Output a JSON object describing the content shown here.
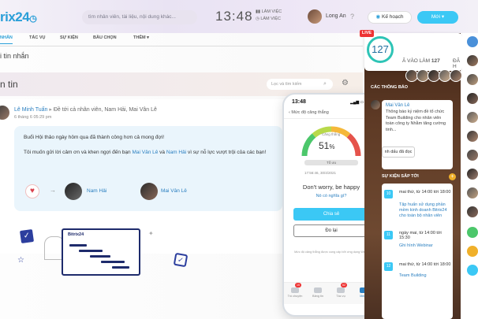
{
  "header": {
    "logo_text": "rix24",
    "search_placeholder": "tìm nhân viên, tài liệu, nội dung khác...",
    "clock": "13:48",
    "work_status_1": "LÀM VIỆC",
    "work_status_2": "LÀM VIỆC",
    "user_name": "Long An",
    "plan_button": "Kế hoạch",
    "new_button": "Mới"
  },
  "tabs": [
    "NHẮN",
    "TÁC VỤ",
    "SỰ KIỆN",
    "BẦU CHỌN",
    "THÊM ▾"
  ],
  "breadcrumb": "i tin nhắn",
  "page_title": "n tin",
  "filter_placeholder": "Lọc và tìm kiếm",
  "post": {
    "author": "Lê Minh Tuấn",
    "recipients": "Đề tới cả nhân viên, Nam Hải, Mai Vân Lê",
    "date": "6 tháng 6 05:29 pm",
    "line1": "Buổi Hội thảo ngày hôm qua đã thành công hơn cả mong đợi!",
    "line2_a": "Tôi muốn gửi lời cảm ơn và khen ngợi đến bạn ",
    "line2_b": "Mai Vân Lê",
    "line2_c": " và ",
    "line2_d": "Nam Hải",
    "line2_e": " vì sự nỗ lực vượt trội của các bạn!",
    "person1": "Nam Hải",
    "person2": "Mai Vân Lê",
    "board_title": "Bitrix24"
  },
  "phone": {
    "time": "13:48",
    "header": "Mức độ căng thẳng",
    "gauge_label": "Căng thẳng",
    "gauge_value": "51",
    "gauge_unit": "%",
    "gauge_sub": "Tố ưu",
    "date": "17:56:46, 30/4/2021",
    "question": "Don't worry, be happy",
    "link": "Nó có nghĩa gì?",
    "btn_share": "Chia sẻ",
    "btn_retry": "Đo lại",
    "note": "Mức độ căng thẳng được cung cấp bởi ứng dụng Welltory",
    "nav": [
      "Trò chuyện",
      "Bảng tin",
      "Tác vụ",
      "Menu"
    ],
    "nav_badges": [
      "15",
      "",
      "62",
      ""
    ]
  },
  "sidebar": {
    "live": "LIVE",
    "score": "127",
    "stat_label": "Ã VÀO LÀM",
    "stat_value": "127",
    "stat_label2": "ĐÃ H",
    "notice_title": "CÁC THÔNG BÁO",
    "notice_name": "Mai Vân Lê",
    "notice_text": "Thông báo kỷ niệm đề tổ chức Team Building cho nhân viên toàn công ty Nhằm tăng cường tinh...",
    "mark_read": "nh dấu đã đọc",
    "pager": "‹  1 / 1  ›",
    "events_title": "SỰ KIỆN SẮP TỚI",
    "events": [
      {
        "cal": "10",
        "date": "mai thứ, từ 14:00 tới 18:00",
        "title": "Tập huấn sử dụng phần mềm kinh doanh Bitrix24 cho toàn bộ nhân viên"
      },
      {
        "cal": "11",
        "date": "ngày mai, từ 14:00 tới 15:30",
        "title": "Ghi hình Webinar"
      },
      {
        "cal": "12",
        "date": "mai thứ, từ 14:00 tới 18:00",
        "title": "Team Building"
      }
    ]
  },
  "colors": {
    "brand": "#2a9fd8",
    "accent": "#3bc8f5",
    "live": "#e33333",
    "ring": "#2ec4b6"
  }
}
